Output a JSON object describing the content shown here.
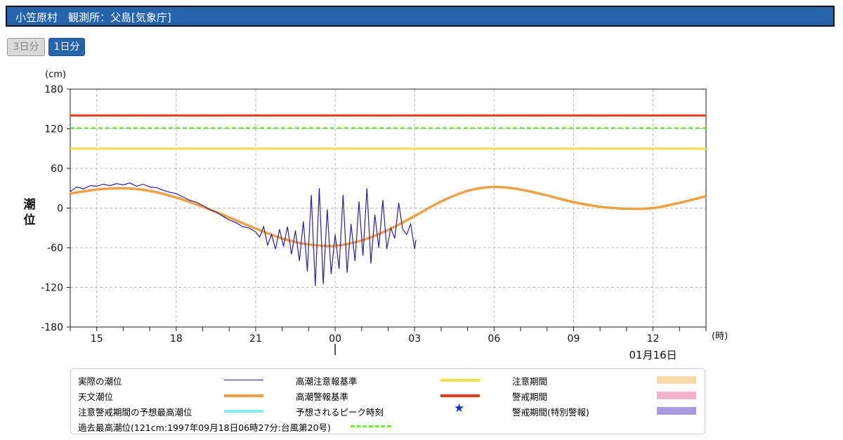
{
  "header": {
    "title": "小笠原村　観測所：父島[気象庁]"
  },
  "buttons": {
    "three_day": "3日分",
    "one_day": "1日分"
  },
  "colors": {
    "header_bg": "#2563ad",
    "actual": "#2b1fa8",
    "astronomical": "#f0a040",
    "caution": "#f5e04a",
    "warning": "#e8391c",
    "record": "#66ee33",
    "predicted_peak": "#7ff0f0",
    "caution_period": "#f8d9a8",
    "warning_period": "#f2b3cc",
    "special_warning_period": "#a89ae0",
    "star": "#1b2fc9"
  },
  "chart_data": {
    "type": "line",
    "ylabel": "潮位",
    "yunit": "(cm)",
    "xunit": "(時)",
    "ylim": [
      -180,
      180
    ],
    "yticks": [
      180,
      120,
      60,
      0,
      -60,
      -120,
      -180
    ],
    "x_range_hours": [
      14,
      38
    ],
    "xticks": [
      {
        "h": 15,
        "label": "15"
      },
      {
        "h": 18,
        "label": "18"
      },
      {
        "h": 21,
        "label": "21"
      },
      {
        "h": 24,
        "label": "00"
      },
      {
        "h": 27,
        "label": "03"
      },
      {
        "h": 30,
        "label": "06"
      },
      {
        "h": 33,
        "label": "09"
      },
      {
        "h": 36,
        "label": "12"
      }
    ],
    "date_label": "01月16日",
    "grid": true,
    "thresholds": {
      "warning": 140,
      "record": 121,
      "caution": 90
    },
    "series": [
      {
        "name": "天文潮位",
        "x": [
          14,
          15,
          16,
          17,
          18,
          19,
          20,
          21,
          22,
          23,
          24,
          25,
          26,
          27,
          28,
          29,
          30,
          31,
          32,
          33,
          34,
          35,
          36,
          37,
          38
        ],
        "y": [
          22,
          28,
          30,
          26,
          16,
          2,
          -14,
          -31,
          -46,
          -55,
          -57,
          -49,
          -33,
          -12,
          10,
          26,
          32,
          28,
          19,
          9,
          2,
          -1,
          0,
          8,
          18
        ]
      },
      {
        "name": "実際の潮位",
        "x": [
          14.0,
          14.25,
          14.5,
          14.75,
          15.0,
          15.25,
          15.5,
          15.75,
          16.0,
          16.25,
          16.5,
          16.75,
          17.0,
          17.25,
          17.5,
          17.75,
          18.0,
          18.25,
          18.5,
          18.75,
          19.0,
          19.25,
          19.5,
          19.75,
          20.0,
          20.25,
          20.5,
          20.75,
          21.0,
          21.15,
          21.3,
          21.45,
          21.6,
          21.75,
          21.9,
          22.05,
          22.2,
          22.35,
          22.5,
          22.65,
          22.8,
          22.95,
          23.1,
          23.25,
          23.4,
          23.55,
          23.7,
          23.85,
          24.0,
          24.15,
          24.3,
          24.45,
          24.6,
          24.75,
          24.9,
          25.05,
          25.2,
          25.35,
          25.5,
          25.65,
          25.8,
          25.95,
          26.1,
          26.25,
          26.4,
          26.55,
          26.7,
          26.85,
          27.0,
          27.05
        ],
        "y": [
          25,
          32,
          29,
          34,
          33,
          36,
          34,
          37,
          35,
          38,
          33,
          36,
          32,
          31,
          27,
          24,
          22,
          17,
          12,
          9,
          4,
          -2,
          -6,
          -12,
          -18,
          -22,
          -28,
          -30,
          -36,
          -44,
          -28,
          -56,
          -40,
          -62,
          -32,
          -58,
          -28,
          -70,
          -34,
          -80,
          -20,
          -96,
          20,
          -118,
          30,
          -115,
          -2,
          -100,
          -40,
          -92,
          20,
          -98,
          -24,
          -80,
          10,
          -72,
          30,
          -84,
          -10,
          -60,
          12,
          -62,
          -30,
          -46,
          8,
          -32,
          -40,
          -24,
          -62,
          -48
        ]
      }
    ]
  },
  "legend": {
    "actual": "実際の潮位",
    "astronomical": "天文潮位",
    "predicted_peak_level": "注意警戒期間の予想最高潮位",
    "record": "過去最高潮位(121cm:1997年09月18日06時27分:台風第20号)",
    "caution_line": "高潮注意報基準",
    "warning_line": "高潮警報基準",
    "peak_time": "予想されるピーク時刻",
    "caution_period": "注意期間",
    "warning_period": "警戒期間",
    "special_warning_period": "警戒期間(特別警報)"
  }
}
